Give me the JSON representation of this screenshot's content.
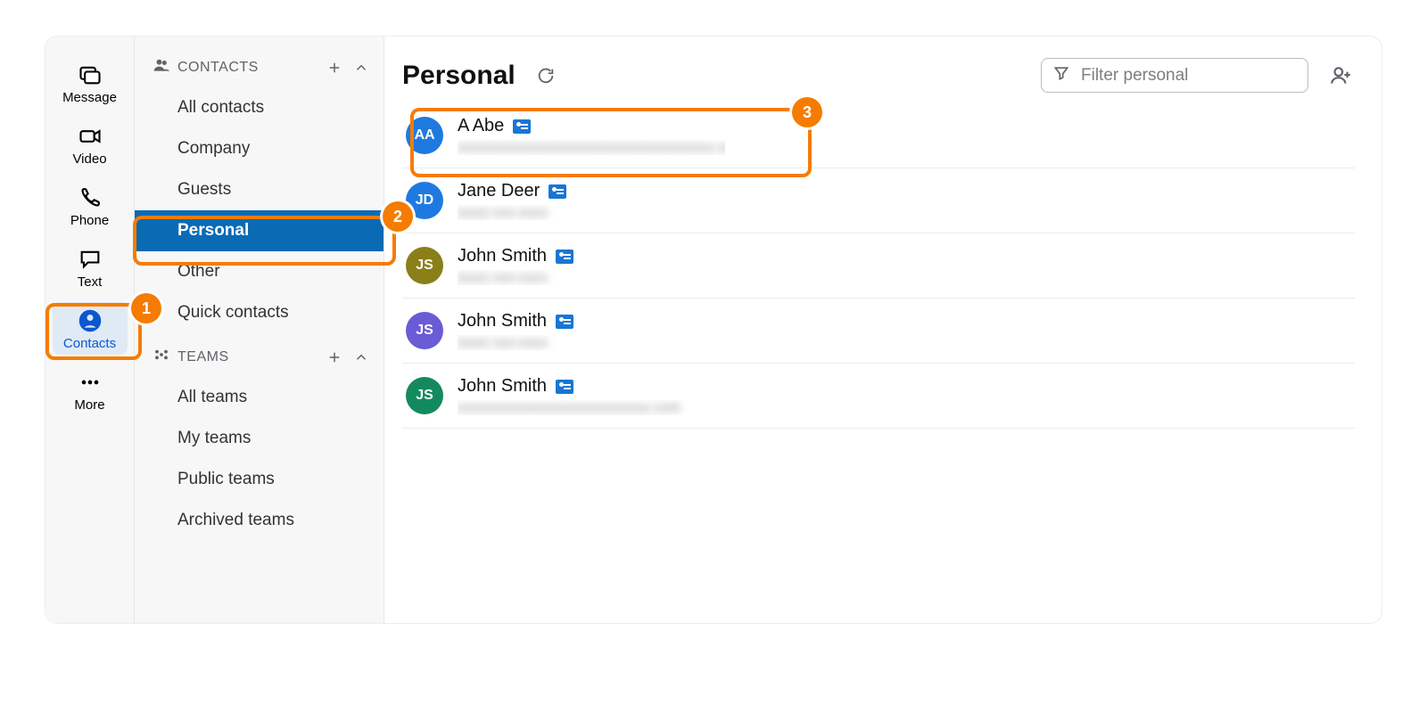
{
  "rail": {
    "items": [
      {
        "label": "Message",
        "icon": "message-icon"
      },
      {
        "label": "Video",
        "icon": "video-icon"
      },
      {
        "label": "Phone",
        "icon": "phone-icon"
      },
      {
        "label": "Text",
        "icon": "text-icon"
      },
      {
        "label": "Contacts",
        "icon": "contacts-icon",
        "active": true
      },
      {
        "label": "More",
        "icon": "more-icon"
      }
    ]
  },
  "sidebar": {
    "contacts_header": "CONTACTS",
    "teams_header": "TEAMS",
    "contacts_items": [
      {
        "label": "All contacts"
      },
      {
        "label": "Company"
      },
      {
        "label": "Guests"
      },
      {
        "label": "Personal",
        "active": true
      },
      {
        "label": "Other"
      },
      {
        "label": "Quick contacts"
      }
    ],
    "teams_items": [
      {
        "label": "All teams"
      },
      {
        "label": "My teams"
      },
      {
        "label": "Public teams"
      },
      {
        "label": "Archived teams"
      }
    ]
  },
  "header": {
    "title": "Personal",
    "filter_placeholder": "Filter personal"
  },
  "contacts": [
    {
      "initials": "AA",
      "name": "A Abe",
      "color": "#1f7ae0",
      "sub": "xxxxxxxxxxxxxxxxxxxxxxxxxxxxxxxxxxxx.com"
    },
    {
      "initials": "JD",
      "name": "Jane Deer",
      "color": "#1f7ae0",
      "sub": "(xxx) xxx-xxxx"
    },
    {
      "initials": "JS",
      "name": "John Smith",
      "color": "#8a7f19",
      "sub": "(xxx) xxx-xxxx"
    },
    {
      "initials": "JS",
      "name": "John Smith",
      "color": "#6a5bd6",
      "sub": "(xxx) xxx-xxxx"
    },
    {
      "initials": "JS",
      "name": "John Smith",
      "color": "#138a5e",
      "sub": "xxxxxxxxxxxxxxxxxxxxxxxxxxx.com"
    }
  ],
  "annotations": {
    "b1": "1",
    "b2": "2",
    "b3": "3"
  }
}
